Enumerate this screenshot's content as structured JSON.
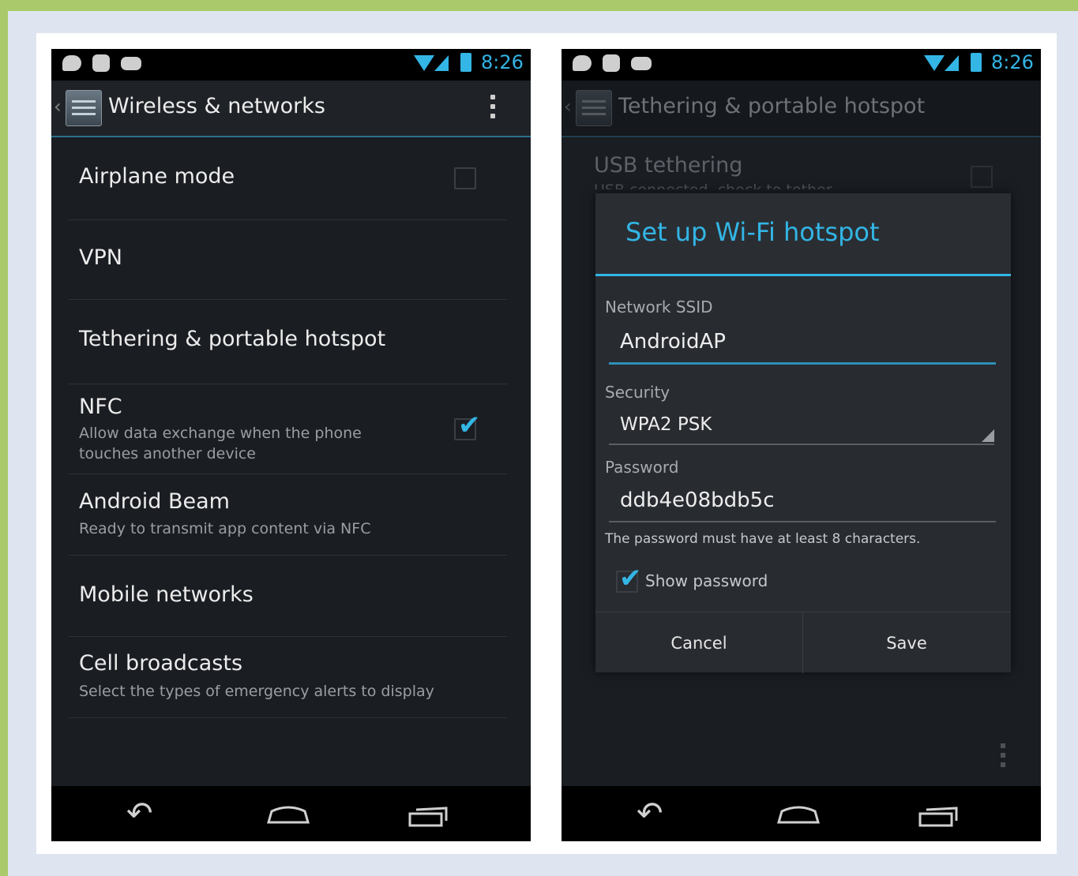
{
  "status_bar": {
    "time": "8:26"
  },
  "phone1": {
    "action_bar": {
      "title": "Wireless & networks"
    },
    "items": [
      {
        "title": "Airplane mode",
        "checked": false
      },
      {
        "title": "VPN"
      },
      {
        "title": "Tethering & portable hotspot"
      },
      {
        "title": "NFC",
        "subtitle_line1": "Allow data exchange when the phone",
        "subtitle_line2": "touches another device",
        "checked": true
      },
      {
        "title": "Android Beam",
        "subtitle": "Ready to transmit app content via NFC"
      },
      {
        "title": "Mobile networks"
      },
      {
        "title": "Cell broadcasts",
        "subtitle": "Select the types of emergency alerts to display"
      }
    ]
  },
  "phone2": {
    "action_bar": {
      "title": "Tethering & portable hotspot"
    },
    "usb_tethering": {
      "title": "USB tethering",
      "subtitle": "USB connected, check to tether"
    },
    "dialog": {
      "title": "Set up Wi-Fi hotspot",
      "ssid_label": "Network SSID",
      "ssid_value": "AndroidAP",
      "security_label": "Security",
      "security_value": "WPA2 PSK",
      "password_label": "Password",
      "password_value": "ddb4e08bdb5c",
      "password_hint": "The password must have at least 8 characters.",
      "show_password_label": "Show password",
      "show_password_checked": true,
      "cancel_label": "Cancel",
      "save_label": "Save"
    }
  },
  "icons": {
    "notifications": [
      "chat-icon",
      "check-icon",
      "gamepad-icon"
    ],
    "status": [
      "wifi-icon",
      "signal-icon",
      "battery-icon"
    ],
    "nav": [
      "back-icon",
      "home-icon",
      "recent-apps-icon"
    ]
  },
  "colors": {
    "accent": "#33b5e5",
    "frame": "#aac96a",
    "background": "#1a1d22"
  }
}
